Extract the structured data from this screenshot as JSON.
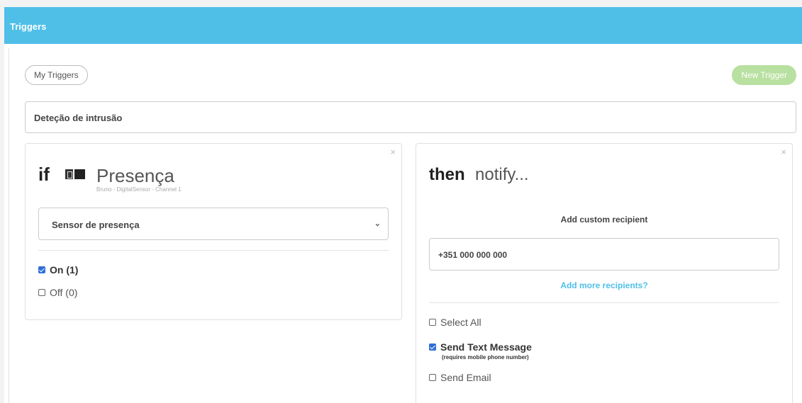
{
  "header": {
    "title": "Triggers"
  },
  "toolbar": {
    "my_triggers": "My Triggers",
    "new_trigger": "New Trigger"
  },
  "trigger_name": "Deteção de intrusão",
  "condition": {
    "if_label": "if",
    "device_name": "Presença",
    "device_sub": "Bruno - DigitalSensor - Channel 1",
    "selected_option": "Sensor de presença",
    "options": [
      {
        "label": "On (1)",
        "checked": true
      },
      {
        "label": "Off (0)",
        "checked": false
      }
    ],
    "close": "×"
  },
  "action": {
    "then_label": "then",
    "notify_label": "notify...",
    "add_custom": "Add custom recipient",
    "phone_value": "+351 000 000 000",
    "add_more": "Add more recipients?",
    "select_all": "Select All",
    "send_text": "Send Text Message",
    "send_text_note": "(requires mobile phone number)",
    "send_email": "Send Email",
    "close": "×"
  }
}
